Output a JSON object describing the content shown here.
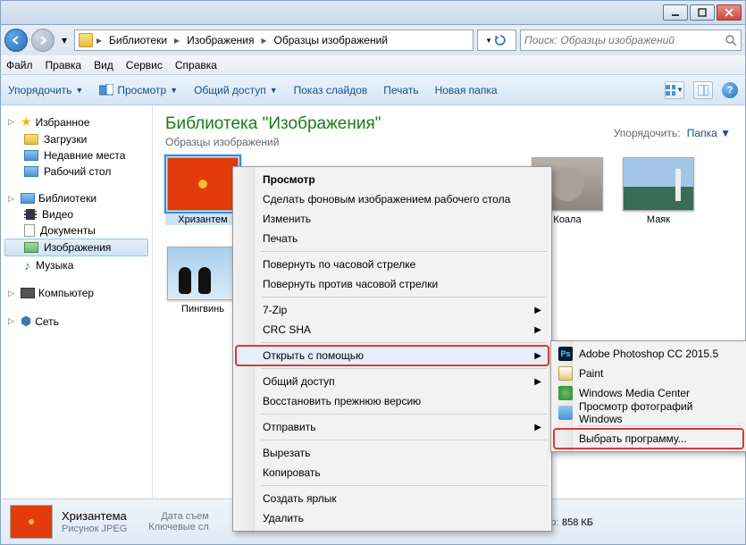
{
  "window": {
    "minimize": "_",
    "maximize": "☐",
    "close": "✕"
  },
  "address": {
    "crumbs": [
      "Библиотеки",
      "Изображения",
      "Образцы изображений"
    ]
  },
  "search": {
    "placeholder": "Поиск: Образцы изображений"
  },
  "menubar": [
    "Файл",
    "Правка",
    "Вид",
    "Сервис",
    "Справка"
  ],
  "toolbar": {
    "organize": "Упорядочить",
    "view": "Просмотр",
    "share": "Общий доступ",
    "slideshow": "Показ слайдов",
    "print": "Печать",
    "newfolder": "Новая папка"
  },
  "sidebar": {
    "favorites": {
      "label": "Избранное",
      "items": [
        "Загрузки",
        "Недавние места",
        "Рабочий стол"
      ]
    },
    "libraries": {
      "label": "Библиотеки",
      "items": [
        "Видео",
        "Документы",
        "Изображения",
        "Музыка"
      ],
      "selected": 2
    },
    "computer": "Компьютер",
    "network": "Сеть"
  },
  "library": {
    "title": "Библиотека \"Изображения\"",
    "subtitle": "Образцы изображений",
    "sort_label": "Упорядочить:",
    "sort_value": "Папка"
  },
  "thumbs": [
    {
      "label": "Хризантем",
      "cls": "i-flower",
      "selected": true
    },
    {
      "label": "Коала",
      "cls": "i-koala"
    },
    {
      "label": "Маяк",
      "cls": "i-light"
    },
    {
      "label": "Пингвинь",
      "cls": "i-peng"
    }
  ],
  "contextmenu": {
    "items": [
      {
        "label": "Просмотр",
        "default": true
      },
      {
        "label": "Сделать фоновым изображением рабочего стола"
      },
      {
        "label": "Изменить"
      },
      {
        "label": "Печать"
      },
      {
        "sep": true
      },
      {
        "label": "Повернуть по часовой стрелке"
      },
      {
        "label": "Повернуть против часовой стрелки"
      },
      {
        "sep": true
      },
      {
        "label": "7-Zip",
        "arrow": true
      },
      {
        "label": "CRC SHA",
        "arrow": true
      },
      {
        "sep": true
      },
      {
        "label": "Открыть с помощью",
        "arrow": true,
        "highlight": true
      },
      {
        "sep": true
      },
      {
        "label": "Общий доступ",
        "arrow": true
      },
      {
        "label": "Восстановить прежнюю версию"
      },
      {
        "sep": true
      },
      {
        "label": "Отправить",
        "arrow": true
      },
      {
        "sep": true
      },
      {
        "label": "Вырезать"
      },
      {
        "label": "Копировать"
      },
      {
        "sep": true
      },
      {
        "label": "Создать ярлык"
      },
      {
        "label": "Удалить"
      }
    ]
  },
  "submenu": {
    "apps": [
      {
        "label": "Adobe Photoshop CC 2015.5",
        "ico": "ai-ps",
        "tag": "Ps"
      },
      {
        "label": "Paint",
        "ico": "ai-paint"
      },
      {
        "label": "Windows Media Center",
        "ico": "ai-wmc"
      },
      {
        "label": "Просмотр фотографий Windows",
        "ico": "ai-pv"
      }
    ],
    "choose": "Выбрать программу..."
  },
  "details": {
    "title": "Хризантема",
    "type": "Рисунок JPEG",
    "col1_label": "Дата съем",
    "col2_label": "Ключевые сл",
    "size_label": "Размер:",
    "size_value": "858 КБ"
  }
}
